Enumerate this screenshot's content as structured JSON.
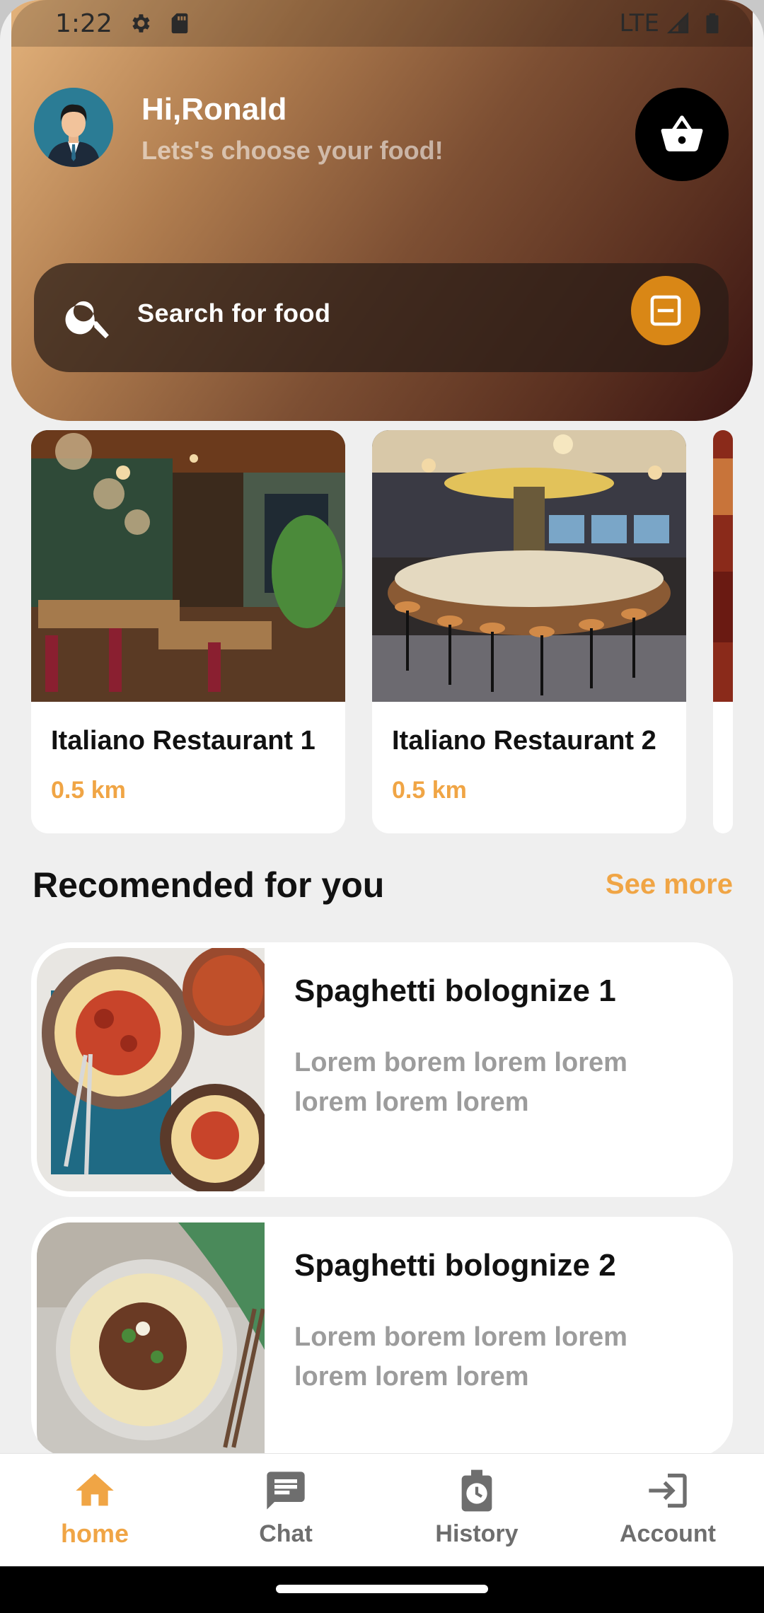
{
  "status_bar": {
    "time": "1:22",
    "network": "LTE",
    "icons": [
      "settings-gear-icon",
      "sd-card-icon",
      "signal-icon",
      "battery-icon"
    ]
  },
  "header": {
    "greeting": "Hi,Ronald",
    "subtitle": "Lets's choose your food!",
    "cart_icon": "basket-icon"
  },
  "search": {
    "placeholder": "Search for food",
    "search_icon": "search-icon",
    "filter_icon": "filter-icon"
  },
  "restaurants": [
    {
      "name": "Italiano Restaurant 1",
      "distance": "0.5 km"
    },
    {
      "name": "Italiano Restaurant 2",
      "distance": "0.5 km"
    }
  ],
  "recommended": {
    "title": "Recomended for you",
    "see_more": "See more",
    "items": [
      {
        "title": "Spaghetti bolognize 1",
        "description": "Lorem borem lorem lorem lorem lorem lorem"
      },
      {
        "title": "Spaghetti bolognize 2",
        "description": "Lorem borem lorem lorem lorem lorem lorem"
      }
    ]
  },
  "bottom_nav": {
    "items": [
      {
        "label": "home",
        "icon": "home-icon",
        "active": true
      },
      {
        "label": "Chat",
        "icon": "chat-icon",
        "active": false
      },
      {
        "label": "History",
        "icon": "history-icon",
        "active": false
      },
      {
        "label": "Account",
        "icon": "login-icon",
        "active": false
      }
    ]
  },
  "colors": {
    "accent": "#f0a545",
    "filter_button": "#d98716",
    "background": "#efefef"
  }
}
